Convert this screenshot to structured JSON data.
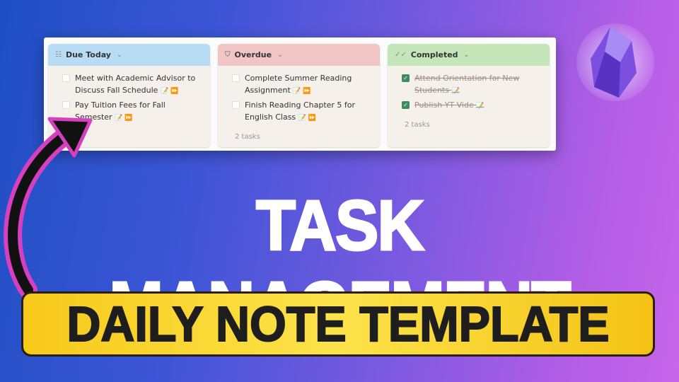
{
  "board": {
    "columns": [
      {
        "title": "Due Today",
        "icon": "list-icon",
        "color": "#b9dcf5",
        "tasks": [
          {
            "text": "Meet with Academic Advisor to Discuss Fall Schedule",
            "done": false,
            "emoji": "📝 ⏩"
          },
          {
            "text": "Pay Tuition Fees for Fall Semester",
            "done": false,
            "emoji": "📝 ⏩"
          }
        ],
        "count": ""
      },
      {
        "title": "Overdue",
        "icon": "shield-icon",
        "color": "#f2c5c5",
        "tasks": [
          {
            "text": "Complete Summer Reading Assignment",
            "done": false,
            "emoji": "📝 ⏩"
          },
          {
            "text": "Finish Reading Chapter 5 for English Class",
            "done": false,
            "emoji": "📝 ⏩"
          }
        ],
        "count": "2 tasks"
      },
      {
        "title": "Completed",
        "icon": "check-double-icon",
        "color": "#c4e6b8",
        "tasks": [
          {
            "text": "Attend Orientation for New Students",
            "done": true,
            "emoji": "📝"
          },
          {
            "text": "Publish YT Vide",
            "done": true,
            "emoji": "📝"
          }
        ],
        "count": "2 tasks"
      }
    ]
  },
  "headline": "TASK MANAGEMENT",
  "banner": "DAILY NOTE TEMPLATE",
  "colors": {
    "banner": "#fde34a",
    "arrow_outline": "#d63fc0",
    "arrow_fill": "#111111"
  }
}
